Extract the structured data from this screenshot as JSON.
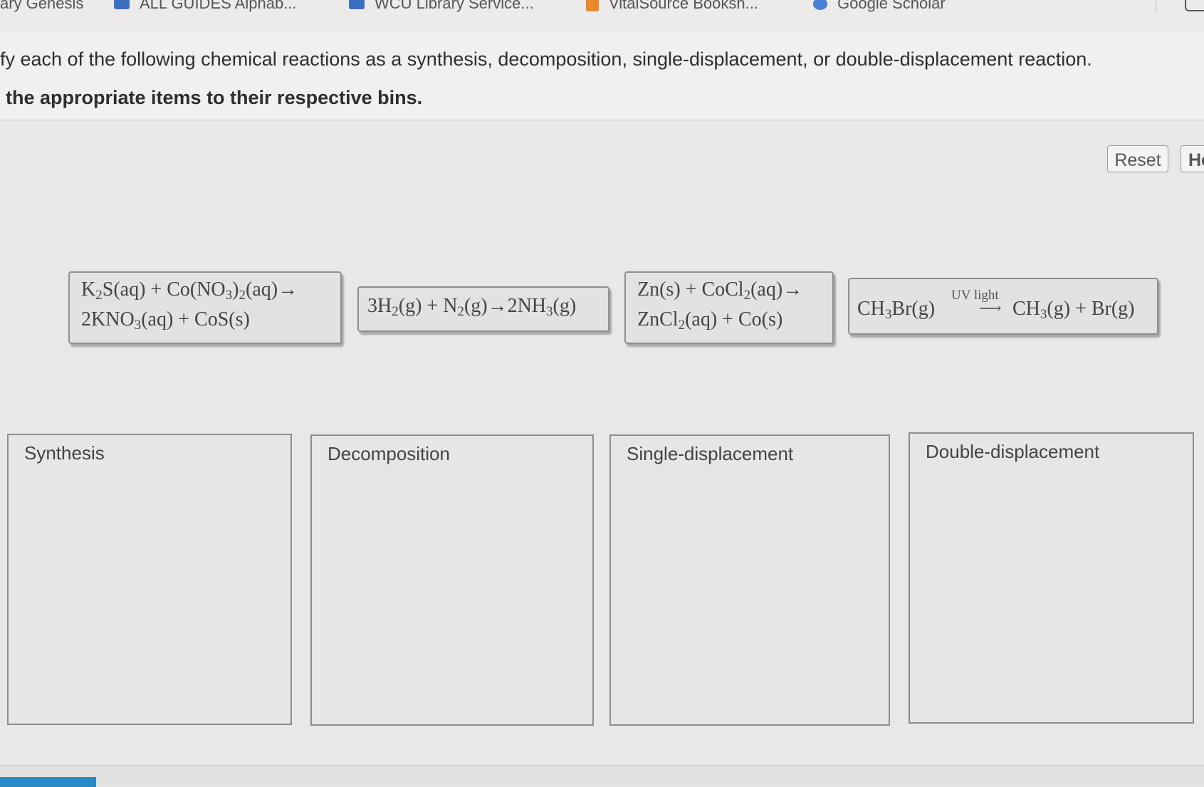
{
  "bookmarks": [
    {
      "label": "ary Genesis",
      "icon": "bookmark-icon"
    },
    {
      "label": "ALL GUIDES Alphab...",
      "icon": "folder-icon"
    },
    {
      "label": "WCU Library Service...",
      "icon": "folder-icon"
    },
    {
      "label": "VitalSource Booksh...",
      "icon": "bookmark-orange-icon"
    },
    {
      "label": "Google Scholar",
      "icon": "scholar-icon"
    }
  ],
  "instructions": {
    "line1": "ify each of the following chemical reactions as a synthesis, decomposition, single-displacement, or double-displacement reaction.",
    "line2": "the appropriate items to their respective bins."
  },
  "buttons": {
    "reset": "Reset",
    "help": "He"
  },
  "reactions": [
    {
      "id": "double-displacement-reaction",
      "line1": "K₂S(aq) + Co(NO₃)₂(aq)→",
      "line2": "2KNO₃(aq) + CoS(s)"
    },
    {
      "id": "synthesis-reaction",
      "line1": "3H₂(g) + N₂(g)→2NH₃(g)"
    },
    {
      "id": "single-displacement-reaction",
      "line1": "Zn(s) + CoCl₂(aq)→",
      "line2": "ZnCl₂(aq) + Co(s)"
    },
    {
      "id": "decomposition-reaction",
      "reactant": "CH₃Br(g)",
      "condition": "UV light",
      "products": "CH₃(g) + Br(g)"
    }
  ],
  "bins": [
    "Synthesis",
    "Decomposition",
    "Single-displacement",
    "Double-displacement"
  ]
}
